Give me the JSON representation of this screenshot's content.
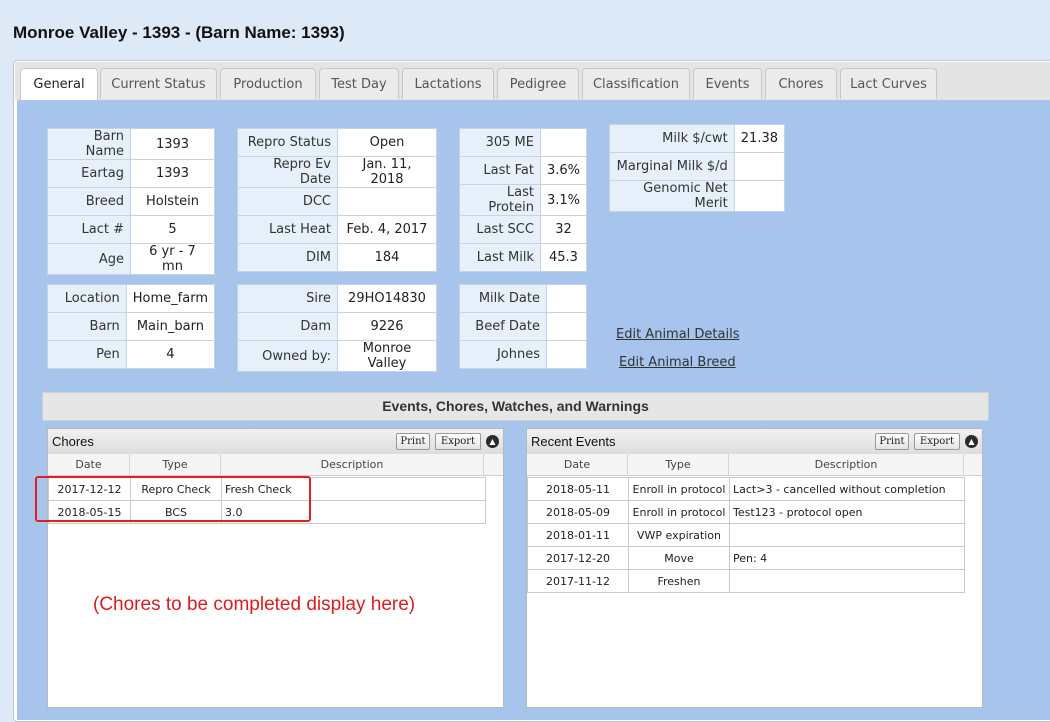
{
  "page": {
    "title": "Monroe Valley - 1393 - (Barn Name: 1393)"
  },
  "tabs": [
    "General",
    "Current Status",
    "Production",
    "Test Day",
    "Lactations",
    "Pedigree",
    "Classification",
    "Events",
    "Chores",
    "Lact Curves"
  ],
  "general": {
    "id_table": [
      {
        "label": "Barn Name",
        "value": "1393"
      },
      {
        "label": "Eartag",
        "value": "1393"
      },
      {
        "label": "Breed",
        "value": "Holstein"
      },
      {
        "label": "Lact #",
        "value": "5"
      },
      {
        "label": "Age",
        "value": "6 yr - 7 mn"
      }
    ],
    "repro_table": [
      {
        "label": "Repro Status",
        "value": "Open"
      },
      {
        "label": "Repro Ev Date",
        "value": "Jan. 11, 2018"
      },
      {
        "label": "DCC",
        "value": ""
      },
      {
        "label": "Last Heat",
        "value": "Feb. 4, 2017"
      },
      {
        "label": "DIM",
        "value": "184"
      }
    ],
    "milk_table": [
      {
        "label": "305 ME",
        "value": ""
      },
      {
        "label": "Last Fat",
        "value": "3.6%"
      },
      {
        "label": "Last Protein",
        "value": "3.1%"
      },
      {
        "label": "Last SCC",
        "value": "32"
      },
      {
        "label": "Last Milk",
        "value": "45.3"
      }
    ],
    "econ_table": [
      {
        "label": "Milk $/cwt",
        "value": "21.38"
      },
      {
        "label": "Marginal Milk $/d",
        "value": ""
      },
      {
        "label": "Genomic Net Merit",
        "value": ""
      }
    ],
    "location_table": [
      {
        "label": "Location",
        "value": "Home_farm"
      },
      {
        "label": "Barn",
        "value": "Main_barn"
      },
      {
        "label": "Pen",
        "value": "4"
      }
    ],
    "sire_table": [
      {
        "label": "Sire",
        "value": "29HO14830"
      },
      {
        "label": "Dam",
        "value": "9226"
      },
      {
        "label": "Owned by:",
        "value": "Monroe Valley"
      }
    ],
    "dates_table": [
      {
        "label": "Milk Date",
        "value": ""
      },
      {
        "label": "Beef Date",
        "value": ""
      },
      {
        "label": "Johnes",
        "value": ""
      }
    ],
    "links": {
      "edit_details": "Edit Animal Details",
      "edit_breed": "Edit Animal Breed"
    }
  },
  "events_section": {
    "header": "Events, Chores, Watches, and Warnings"
  },
  "chores": {
    "title": "Chores",
    "print_label": "Print",
    "export_label": "Export",
    "columns": [
      "Date",
      "Type",
      "Description"
    ],
    "rows": [
      {
        "date": "2017-12-12",
        "type": "Repro Check",
        "description": "Fresh Check"
      },
      {
        "date": "2018-05-15",
        "type": "BCS",
        "description": "3.0"
      }
    ],
    "annotation": "(Chores to be completed display here)",
    "annotation_color": "#e01b1b"
  },
  "recent_events": {
    "title": "Recent Events",
    "print_label": "Print",
    "export_label": "Export",
    "columns": [
      "Date",
      "Type",
      "Description"
    ],
    "rows": [
      {
        "date": "2018-05-11",
        "type": "Enroll in protocol",
        "description": "Lact>3 - cancelled without completion"
      },
      {
        "date": "2018-05-09",
        "type": "Enroll in protocol",
        "description": "Test123 - protocol open"
      },
      {
        "date": "2018-01-11",
        "type": "VWP expiration",
        "description": ""
      },
      {
        "date": "2017-12-20",
        "type": "Move",
        "description": "Pen: 4"
      },
      {
        "date": "2017-11-12",
        "type": "Freshen",
        "description": ""
      }
    ]
  },
  "colors": {
    "content_bg": "#a6c4ec",
    "label_bg": "#e6f0fb",
    "highlight": "#e02020"
  }
}
